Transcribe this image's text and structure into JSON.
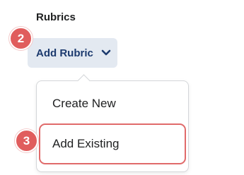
{
  "section": {
    "heading": "Rubrics"
  },
  "add_rubric_button": {
    "label": "Add Rubric",
    "icon": "chevron-down-icon"
  },
  "menu": {
    "items": [
      {
        "label": "Create New"
      },
      {
        "label": "Add Existing",
        "highlighted": true
      }
    ]
  },
  "steps": {
    "button_step": "2",
    "menu_step": "3"
  },
  "colors": {
    "button_bg": "#e3e9f1",
    "button_text": "#1c3a6e",
    "badge": "#e05d5d",
    "highlight_border": "#e06a6a"
  }
}
